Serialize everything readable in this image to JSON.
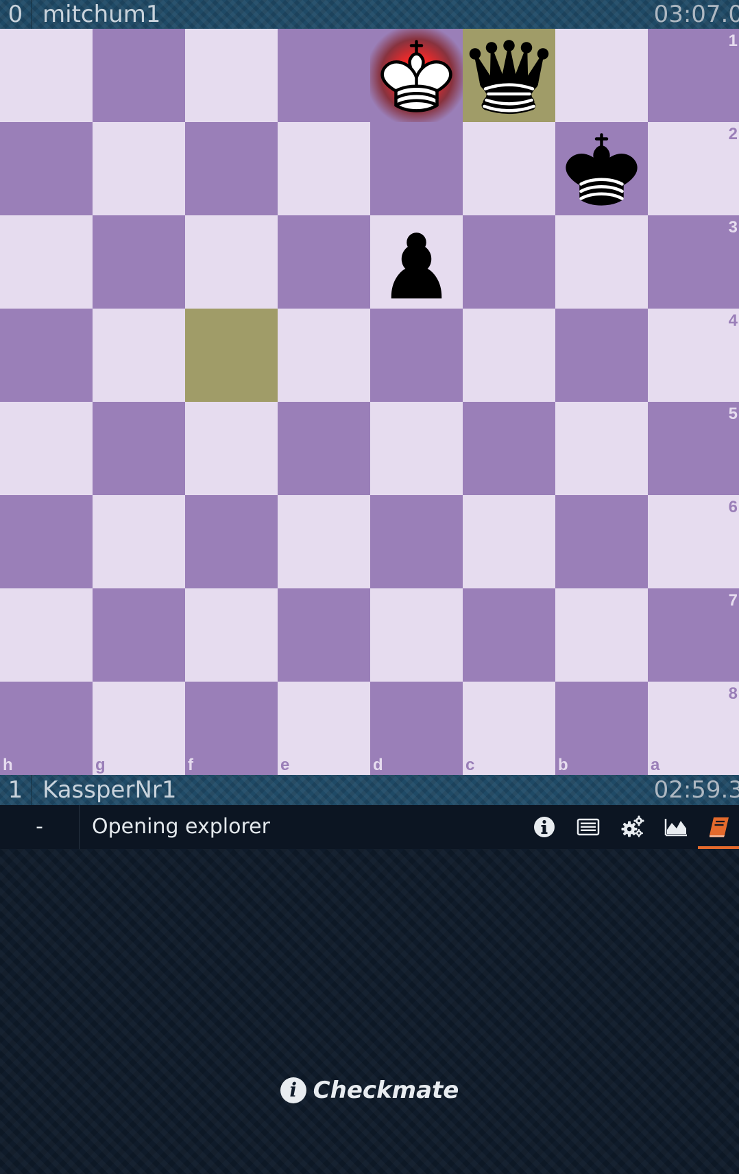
{
  "top_player": {
    "rating": "0",
    "name": "mitchum1",
    "clock": "03:07.0"
  },
  "bottom_player": {
    "rating": "1",
    "name": "KassperNr1",
    "clock": "02:59.3"
  },
  "board": {
    "orientation": "black",
    "files": [
      "h",
      "g",
      "f",
      "e",
      "d",
      "c",
      "b",
      "a"
    ],
    "ranks": [
      "1",
      "2",
      "3",
      "4",
      "5",
      "6",
      "7",
      "8"
    ],
    "pieces": [
      {
        "square": "d1",
        "piece": "white-king",
        "in_check": true
      },
      {
        "square": "c1",
        "piece": "black-queen"
      },
      {
        "square": "b2",
        "piece": "black-king"
      },
      {
        "square": "d3",
        "piece": "black-pawn"
      }
    ],
    "last_move": [
      "f4",
      "c1"
    ],
    "colors": {
      "light": "#e6dcef",
      "dark": "#9a7fb8",
      "highlight": "#a09c68",
      "check": "#ee2a2a"
    }
  },
  "toolbar": {
    "dash": "-",
    "title": "Opening explorer",
    "icons": [
      "info-icon",
      "list-icon",
      "gears-icon",
      "chart-icon",
      "book-icon"
    ],
    "active_tab": "book-icon",
    "accent": "#e46a2c"
  },
  "status": {
    "icon": "info-icon",
    "text": "Checkmate"
  }
}
